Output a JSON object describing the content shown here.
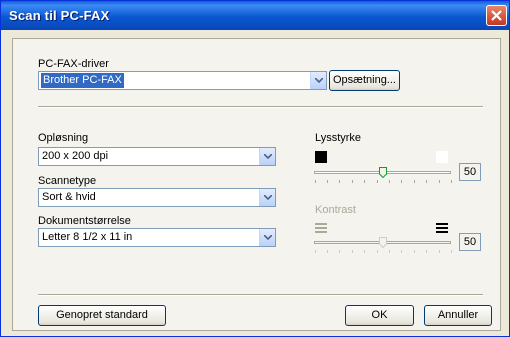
{
  "window": {
    "title": "Scan til PC-FAX"
  },
  "driver": {
    "label": "PC-FAX-driver",
    "value": "Brother PC-FAX",
    "setup_label": "Opsætning..."
  },
  "resolution": {
    "label": "Opløsning",
    "value": "200 x 200 dpi"
  },
  "scantype": {
    "label": "Scannetype",
    "value": "Sort & hvid"
  },
  "docsize": {
    "label": "Dokumentstørrelse",
    "value": "Letter 8 1/2 x 11 in"
  },
  "brightness": {
    "label": "Lysstyrke",
    "value": "50",
    "level": 0.5
  },
  "contrast": {
    "label": "Kontrast",
    "value": "50",
    "level": 0.5,
    "enabled": false
  },
  "buttons": {
    "reset": "Genopret standard",
    "ok": "OK",
    "cancel": "Annuller"
  },
  "icons": {
    "close": "close-icon",
    "dropdown": "chevron-down-icon"
  }
}
